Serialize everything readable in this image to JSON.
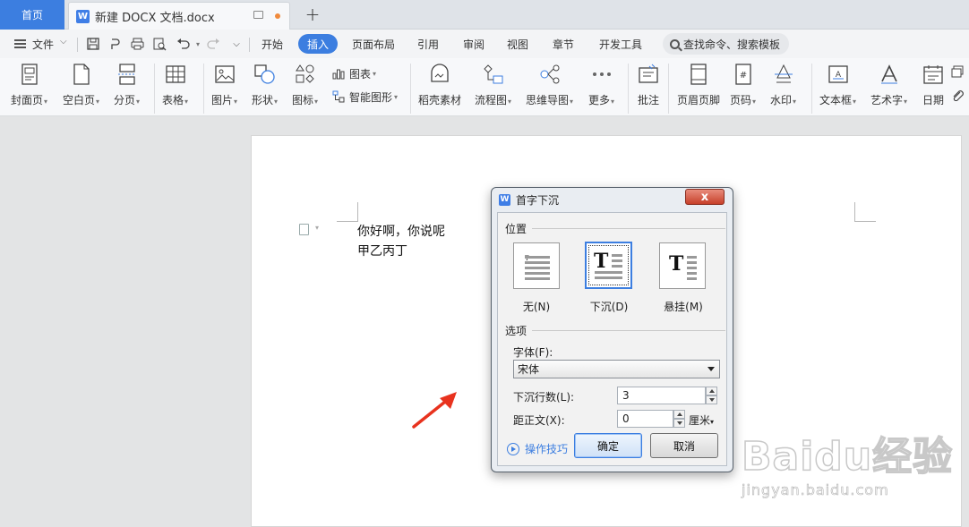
{
  "tabs": {
    "home": "首页",
    "doc_title": "新建 DOCX 文档.docx",
    "add": "+"
  },
  "menu": {
    "file": "文件",
    "items": [
      "开始",
      "插入",
      "页面布局",
      "引用",
      "审阅",
      "视图",
      "章节",
      "开发工具"
    ],
    "active": "插入",
    "search_placeholder": "查找命令、搜索模板"
  },
  "ribbon": {
    "buttons": [
      {
        "label": "封面页",
        "caret": true,
        "icon": "cover-page-icon"
      },
      {
        "label": "空白页",
        "caret": true,
        "icon": "blank-page-icon"
      },
      {
        "label": "分页",
        "caret": true,
        "icon": "page-break-icon"
      },
      {
        "label": "表格",
        "caret": true,
        "icon": "table-icon"
      },
      {
        "label": "图片",
        "caret": true,
        "icon": "picture-icon"
      },
      {
        "label": "形状",
        "caret": true,
        "icon": "shape-icon"
      },
      {
        "label": "图标",
        "caret": true,
        "icon": "icons-icon"
      },
      {
        "label": "稻壳素材",
        "caret": false,
        "icon": "docer-material-icon"
      },
      {
        "label": "流程图",
        "caret": true,
        "icon": "flowchart-icon"
      },
      {
        "label": "思维导图",
        "caret": true,
        "icon": "mindmap-icon"
      },
      {
        "label": "更多",
        "caret": true,
        "icon": "more-icon"
      },
      {
        "label": "批注",
        "caret": false,
        "icon": "comment-icon"
      },
      {
        "label": "页眉页脚",
        "caret": false,
        "icon": "header-footer-icon"
      },
      {
        "label": "页码",
        "caret": true,
        "icon": "page-number-icon"
      },
      {
        "label": "水印",
        "caret": true,
        "icon": "watermark-icon"
      },
      {
        "label": "文本框",
        "caret": true,
        "icon": "textbox-icon"
      },
      {
        "label": "艺术字",
        "caret": true,
        "icon": "wordart-icon"
      },
      {
        "label": "日期",
        "caret": false,
        "icon": "date-icon"
      }
    ],
    "chart_label": "图表",
    "smartart_label": "智能图形"
  },
  "document": {
    "lines": [
      "你好啊，你说呢",
      "甲乙丙丁"
    ]
  },
  "dialog": {
    "title": "首字下沉",
    "close": "x",
    "position_group": "位置",
    "positions": [
      {
        "label": "无(N)",
        "selected": false
      },
      {
        "label": "下沉(D)",
        "selected": true
      },
      {
        "label": "悬挂(M)",
        "selected": false
      }
    ],
    "options_group": "选项",
    "font_label": "字体(F):",
    "font_value": "宋体",
    "lines_label": "下沉行数(L):",
    "lines_value": "3",
    "distance_label": "距正文(X):",
    "distance_value": "0",
    "distance_unit": "厘米",
    "tips_link": "操作技巧",
    "ok": "确定",
    "cancel": "取消"
  },
  "watermark": {
    "brand": "Baidu经验",
    "url": "jingyan.baidu.com"
  },
  "colors": {
    "accent": "#3c7ee0",
    "arrow": "#e8321e"
  }
}
